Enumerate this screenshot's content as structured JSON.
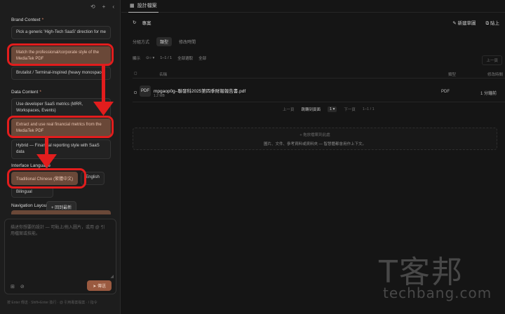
{
  "left_panel": {
    "top_icons": [
      "history-icon",
      "plus-icon",
      "collapse-icon"
    ],
    "brand_context": {
      "title": "Brand Context",
      "required_mark": "*",
      "options": [
        "Pick a generic 'High-Tech SaaS' direction for me",
        "Match the professional/corporate style of the MediaTek PDF",
        "Brutalist / Terminal-inspired (heavy monospace)"
      ]
    },
    "data_content": {
      "title": "Data Content",
      "required_mark": "*",
      "options": [
        "Use developer SaaS metrics (MRR, Workspaces, Events)",
        "Extract and use real financial metrics from the MediaTek PDF",
        "Hybrid — Financial reporting style with SaaS data"
      ]
    },
    "interface_language": {
      "title": "Interface Language",
      "options": [
        "Traditional Chinese (繁體中文)",
        "English",
        "Bilingual"
      ]
    },
    "navigation_layout": {
      "title": "Navigation Layout"
    },
    "rollback_button": "+ 回到最新",
    "composer": {
      "placeholder": "描述你想要的設計 — 可貼上/拖入圖片，或用 @ 引用檔案或技能。",
      "send_label": "傳送",
      "tool_icons": [
        "grid-icon",
        "attach-icon"
      ]
    },
    "footer_note": "按 Enter 傳送 · Shift+Enter 換行 · @ 引用專案檔案 · / 指令"
  },
  "right_panel": {
    "tab_label": "設計檔案",
    "toolbar": {
      "title": "專案",
      "new_sketch": "新建草圖",
      "upload": "貼上"
    },
    "filters": [
      "分組方式",
      "類型",
      "修改時間"
    ],
    "view": {
      "label": "顯示",
      "count": "1–1 / 1",
      "select_all": "全部選取",
      "all": "全部",
      "prev": "上一頁"
    },
    "columns": {
      "name": "名稱",
      "type": "類型",
      "modified": "修改時間"
    },
    "files": [
      {
        "icon": "PDF",
        "name": "mpgaop0g–聯發科2025第四季財報報告書.pdf",
        "size": "1.2 MB",
        "type": "PDF",
        "modified": "1 分鐘前"
      }
    ],
    "pager": {
      "prev": "上一頁",
      "jump": "跳轉到頁面",
      "page_sel": "1",
      "next": "下一頁",
      "count": "1–1 / 1"
    },
    "dropzone": {
      "line1": "+ 拖放檔案到此處",
      "line2": "圖片、文件、參考資料或資料夾 — 智慧體都會用作上下文。"
    }
  },
  "watermark": {
    "line1": "T客邦",
    "line2": "techbang.com"
  },
  "colors": {
    "highlight": "#e21d1d",
    "selected_bg": "#6a4838",
    "send_bg": "#9a5a40"
  }
}
